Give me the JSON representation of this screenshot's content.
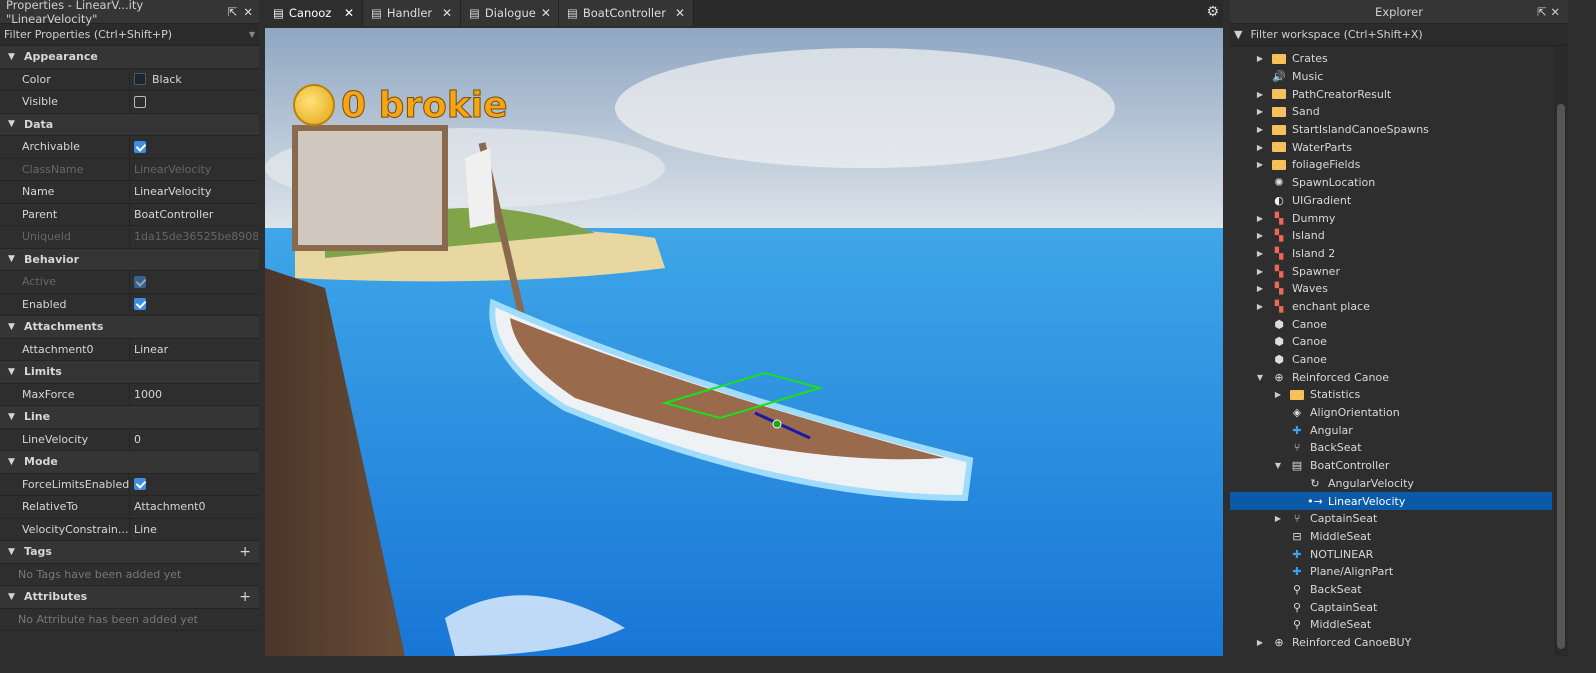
{
  "properties": {
    "title": "Properties - LinearV...ity \"LinearVelocity\"",
    "filter_placeholder": "Filter Properties (Ctrl+Shift+P)",
    "rows": [
      {
        "type": "cat",
        "label": "Appearance"
      },
      {
        "type": "prop",
        "name": "Color",
        "value": "Black",
        "swatch": "#1b2630"
      },
      {
        "type": "prop",
        "name": "Visible",
        "check": false
      },
      {
        "type": "cat",
        "label": "Data"
      },
      {
        "type": "prop",
        "name": "Archivable",
        "check": true
      },
      {
        "type": "prop",
        "name": "ClassName",
        "value": "LinearVelocity",
        "disabled": true
      },
      {
        "type": "prop",
        "name": "Name",
        "value": "LinearVelocity"
      },
      {
        "type": "prop",
        "name": "Parent",
        "value": "BoatController"
      },
      {
        "type": "prop",
        "name": "UniqueId",
        "value": "1da15de36525be8908...",
        "disabled": true
      },
      {
        "type": "cat",
        "label": "Behavior"
      },
      {
        "type": "prop",
        "name": "Active",
        "check": true,
        "disabled": true
      },
      {
        "type": "prop",
        "name": "Enabled",
        "check": true
      },
      {
        "type": "cat",
        "label": "Attachments"
      },
      {
        "type": "prop",
        "name": "Attachment0",
        "value": "Linear"
      },
      {
        "type": "cat",
        "label": "Limits"
      },
      {
        "type": "prop",
        "name": "MaxForce",
        "value": "1000"
      },
      {
        "type": "cat",
        "label": "Line"
      },
      {
        "type": "prop",
        "name": "LineVelocity",
        "value": "0"
      },
      {
        "type": "cat",
        "label": "Mode"
      },
      {
        "type": "prop",
        "name": "ForceLimitsEnabled",
        "check": true
      },
      {
        "type": "prop",
        "name": "RelativeTo",
        "value": "Attachment0"
      },
      {
        "type": "prop",
        "name": "VelocityConstrain...",
        "value": "Line"
      },
      {
        "type": "cat",
        "label": "Tags",
        "plus": true
      },
      {
        "type": "note",
        "label": "No Tags have been added yet"
      },
      {
        "type": "cat",
        "label": "Attributes",
        "plus": true
      },
      {
        "type": "note",
        "label": "No Attribute has been added yet"
      }
    ]
  },
  "tabs": [
    {
      "label": "Canooz",
      "active": true
    },
    {
      "label": "Handler"
    },
    {
      "label": "Dialogue"
    },
    {
      "label": "BoatController"
    }
  ],
  "viewport": {
    "coins": "0 brokie"
  },
  "explorer": {
    "title": "Explorer",
    "filter_placeholder": "Filter workspace (Ctrl+Shift+X)",
    "items": [
      {
        "label": "Crates",
        "level": 1,
        "icon": "folder",
        "arrow": "right"
      },
      {
        "label": "Music",
        "level": 1,
        "icon": "sound"
      },
      {
        "label": "PathCreatorResult",
        "level": 1,
        "icon": "folder",
        "arrow": "right"
      },
      {
        "label": "Sand",
        "level": 1,
        "icon": "folder",
        "arrow": "right"
      },
      {
        "label": "StartIslandCanoeSpawns",
        "level": 1,
        "icon": "folder",
        "arrow": "right"
      },
      {
        "label": "WaterParts",
        "level": 1,
        "icon": "folder",
        "arrow": "right"
      },
      {
        "label": "foliageFields",
        "level": 1,
        "icon": "folder",
        "arrow": "right"
      },
      {
        "label": "SpawnLocation",
        "level": 1,
        "icon": "spawn"
      },
      {
        "label": "UIGradient",
        "level": 1,
        "icon": "gradient"
      },
      {
        "label": "Dummy",
        "level": 1,
        "icon": "model",
        "arrow": "right"
      },
      {
        "label": "Island",
        "level": 1,
        "icon": "model",
        "arrow": "right"
      },
      {
        "label": "Island 2",
        "level": 1,
        "icon": "model",
        "arrow": "right"
      },
      {
        "label": "Spawner",
        "level": 1,
        "icon": "model",
        "arrow": "right"
      },
      {
        "label": "Waves",
        "level": 1,
        "icon": "model",
        "arrow": "right"
      },
      {
        "label": "enchant place",
        "level": 1,
        "icon": "model",
        "arrow": "right"
      },
      {
        "label": "Canoe",
        "level": 1,
        "icon": "package"
      },
      {
        "label": "Canoe",
        "level": 1,
        "icon": "package"
      },
      {
        "label": "Canoe",
        "level": 1,
        "icon": "package"
      },
      {
        "label": "Reinforced Canoe",
        "level": 1,
        "icon": "globe",
        "arrow": "down"
      },
      {
        "label": "Statistics",
        "level": 2,
        "icon": "folder",
        "arrow": "right"
      },
      {
        "label": "AlignOrientation",
        "level": 2,
        "icon": "align"
      },
      {
        "label": "Angular",
        "level": 2,
        "icon": "attach"
      },
      {
        "label": "BackSeat",
        "level": 2,
        "icon": "seat"
      },
      {
        "label": "BoatController",
        "level": 2,
        "icon": "script",
        "arrow": "down"
      },
      {
        "label": "AngularVelocity",
        "level": 3,
        "icon": "angvel"
      },
      {
        "label": "LinearVelocity",
        "level": 3,
        "icon": "linvel",
        "selected": true
      },
      {
        "label": "CaptainSeat",
        "level": 2,
        "icon": "seat",
        "arrow": "right"
      },
      {
        "label": "MiddleSeat",
        "level": 2,
        "icon": "car"
      },
      {
        "label": "NOTLINEAR",
        "level": 2,
        "icon": "attach"
      },
      {
        "label": "Plane/AlignPart",
        "level": 2,
        "icon": "attach"
      },
      {
        "label": "BackSeat",
        "level": 2,
        "icon": "weld"
      },
      {
        "label": "CaptainSeat",
        "level": 2,
        "icon": "weld"
      },
      {
        "label": "MiddleSeat",
        "level": 2,
        "icon": "weld"
      },
      {
        "label": "Reinforced CanoeBUY",
        "level": 1,
        "icon": "globe",
        "arrow": "right"
      }
    ]
  }
}
